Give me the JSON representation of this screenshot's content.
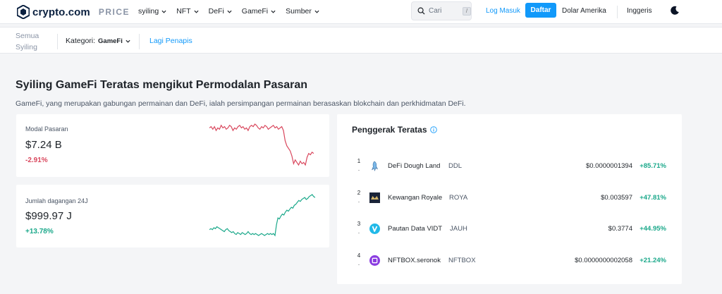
{
  "header": {
    "logo_text": "crypto.com",
    "logo_sub": "PRICE",
    "nav": [
      {
        "label": "syiling"
      },
      {
        "label": "NFT"
      },
      {
        "label": "DeFi"
      },
      {
        "label": "GameFi"
      },
      {
        "label": "Sumber"
      }
    ],
    "search": {
      "placeholder": "Cari",
      "shortcut": "/"
    },
    "login_label": "Log Masuk",
    "signup_label": "Daftar",
    "currency_label": "Dolar Amerika",
    "language_label": "Inggeris",
    "theme_icon": "moon-icon"
  },
  "filters": {
    "all_coins_label": "Semua Syiling",
    "category_label": "Kategori:",
    "category_value": "GameFi",
    "more_filters_label": "Lagi Penapis"
  },
  "main": {
    "title": "Syiling GameFi Teratas mengikut Permodalan Pasaran",
    "description": "GameFi, yang merupakan gabungan permainan dan DeFi, ialah persimpangan permainan berasaskan blokchain dan perkhidmatan DeFi."
  },
  "market_cap": {
    "label": "Modal Pasaran",
    "value": "$7.24 B",
    "change": "-2.91%",
    "color": "#d9475d",
    "sparkline": [
      78,
      79,
      77,
      79,
      76,
      78,
      77,
      80,
      78,
      79,
      77,
      78,
      80,
      79,
      76,
      78,
      77,
      79,
      80,
      78,
      79,
      77,
      78,
      76,
      79,
      80,
      79,
      81,
      80,
      78,
      77,
      79,
      78,
      80,
      79,
      77,
      78,
      79,
      80,
      78,
      79,
      77,
      78,
      79,
      76,
      68,
      64,
      62,
      60,
      56,
      50,
      53,
      51,
      49,
      52,
      50,
      51,
      49,
      55,
      58,
      57,
      59,
      58
    ]
  },
  "volume_24h": {
    "label": "Jumlah dagangan 24J",
    "value": "$999.97 J",
    "change": "+13.78%",
    "color": "#1aa88a",
    "sparkline": [
      40,
      41,
      40,
      42,
      41,
      43,
      42,
      41,
      40,
      39,
      38,
      40,
      41,
      39,
      38,
      37,
      38,
      36,
      35,
      37,
      36,
      35,
      37,
      36,
      35,
      36,
      38,
      36,
      35,
      36,
      35,
      36,
      35,
      34,
      35,
      36,
      35,
      34,
      35,
      36,
      35,
      36,
      35,
      36,
      34,
      45,
      52,
      51,
      54,
      56,
      55,
      58,
      60,
      59,
      61,
      63,
      62,
      65,
      66,
      68,
      70,
      69,
      71,
      72,
      73,
      71,
      72,
      74,
      75,
      76,
      74,
      73
    ]
  },
  "movers": {
    "title": "Penggerak Teratas",
    "rows": [
      {
        "rank": "1",
        "name": "DeFi Dough Land",
        "symbol": "DDL",
        "price": "$0.0000001394",
        "change": "+85.71%",
        "icon": "ddl-icon"
      },
      {
        "rank": "2",
        "name": "Kewangan Royale",
        "symbol": "ROYA",
        "price": "$0.003597",
        "change": "+47.81%",
        "icon": "roya-icon"
      },
      {
        "rank": "3",
        "name": "Pautan Data VIDT",
        "symbol": "JAUH",
        "price": "$0.3774",
        "change": "+44.95%",
        "icon": "vidt-icon"
      },
      {
        "rank": "4",
        "name": "NFTBOX.seronok",
        "symbol": "NFTBOX",
        "price": "$0.0000000002058",
        "change": "+21.24%",
        "icon": "nftbox-icon"
      }
    ]
  }
}
